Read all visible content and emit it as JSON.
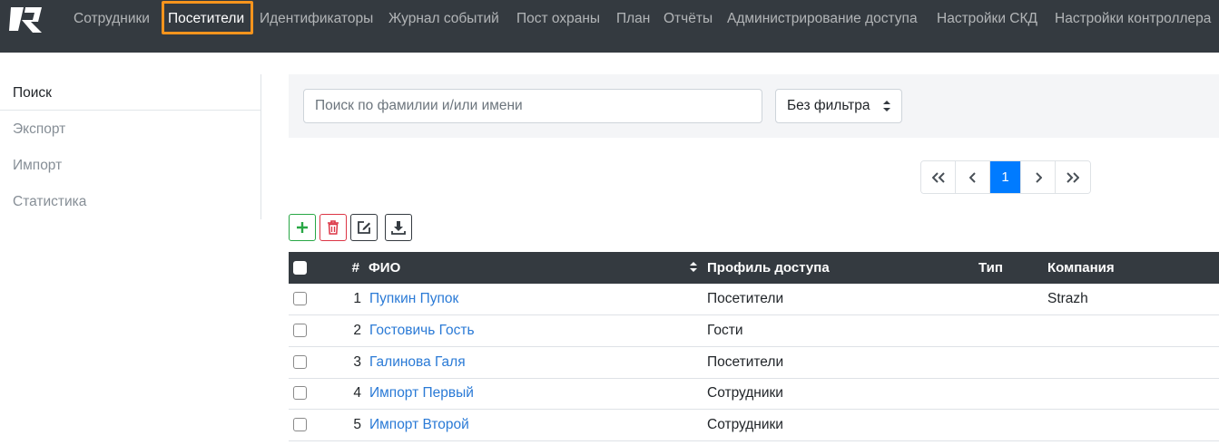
{
  "nav": {
    "items": [
      {
        "label": "Сотрудники"
      },
      {
        "label": "Посетители"
      },
      {
        "label": "Идентификаторы"
      },
      {
        "label": "Журнал событий"
      },
      {
        "label": "Пост охраны"
      },
      {
        "label": "План"
      },
      {
        "label": "Отчёты"
      },
      {
        "label": "Администрирование доступа"
      },
      {
        "label": "Настройки СКД"
      },
      {
        "label": "Настройки контроллера"
      }
    ],
    "active_index": 1,
    "highlight_color": "#f7941d"
  },
  "sidebar": {
    "items": [
      {
        "label": "Поиск"
      },
      {
        "label": "Экспорт"
      },
      {
        "label": "Импорт"
      },
      {
        "label": "Статистика"
      }
    ]
  },
  "search": {
    "placeholder": "Поиск по фамилии и/или имени",
    "value": "",
    "filter_value": "Без фильтра"
  },
  "pagination": {
    "first": "«",
    "prev": "‹",
    "current": "1",
    "next": "›",
    "last": "»"
  },
  "toolbar": {
    "icons": [
      "plus-icon",
      "trash-icon",
      "edit-icon",
      "download-icon"
    ],
    "colors": {
      "add": "#28a745",
      "delete": "#dc3545",
      "dark": "#343a40"
    }
  },
  "table": {
    "headers": {
      "num": "#",
      "name": "ФИО",
      "profile": "Профиль доступа",
      "type": "Тип",
      "company": "Компания"
    },
    "rows": [
      {
        "num": "1",
        "name": "Пупкин Пупок",
        "profile": "Посетители",
        "type": "",
        "company": "Strazh"
      },
      {
        "num": "2",
        "name": "Гостовичь Гость",
        "profile": "Гости",
        "type": "",
        "company": ""
      },
      {
        "num": "3",
        "name": "Галинова Галя",
        "profile": "Посетители",
        "type": "",
        "company": ""
      },
      {
        "num": "4",
        "name": "Импорт Первый",
        "profile": "Сотрудники",
        "type": "",
        "company": ""
      },
      {
        "num": "5",
        "name": "Импорт Второй",
        "profile": "Сотрудники",
        "type": "",
        "company": ""
      }
    ]
  }
}
